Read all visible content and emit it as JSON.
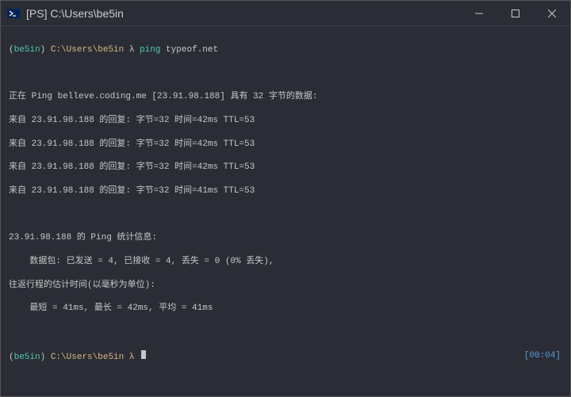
{
  "titlebar": {
    "title": "[PS] C:\\Users\\be5in"
  },
  "prompt1": {
    "lparen": "(",
    "user": "be5in",
    "rparen": ")",
    "path": " C:\\Users\\be5in",
    "lambda": " λ ",
    "cmd": "ping",
    "arg": " typeof.net"
  },
  "output": {
    "l1": "正在 Ping belleve.coding.me [23.91.98.188] 具有 32 字节的数据:",
    "l2": "来自 23.91.98.188 的回复: 字节=32 时间=42ms TTL=53",
    "l3": "来自 23.91.98.188 的回复: 字节=32 时间=42ms TTL=53",
    "l4": "来自 23.91.98.188 的回复: 字节=32 时间=42ms TTL=53",
    "l5": "来自 23.91.98.188 的回复: 字节=32 时间=41ms TTL=53",
    "l6": "23.91.98.188 的 Ping 统计信息:",
    "l7": "    数据包: 已发送 = 4, 已接收 = 4, 丢失 = 0 (0% 丢失),",
    "l8": "往返行程的估计时间(以毫秒为单位):",
    "l9": "    最短 = 41ms, 最长 = 42ms, 平均 = 41ms"
  },
  "prompt2": {
    "lparen": "(",
    "user": "be5in",
    "rparen": ")",
    "path": " C:\\Users\\be5in",
    "lambda": " λ "
  },
  "timer": "[00:04]"
}
